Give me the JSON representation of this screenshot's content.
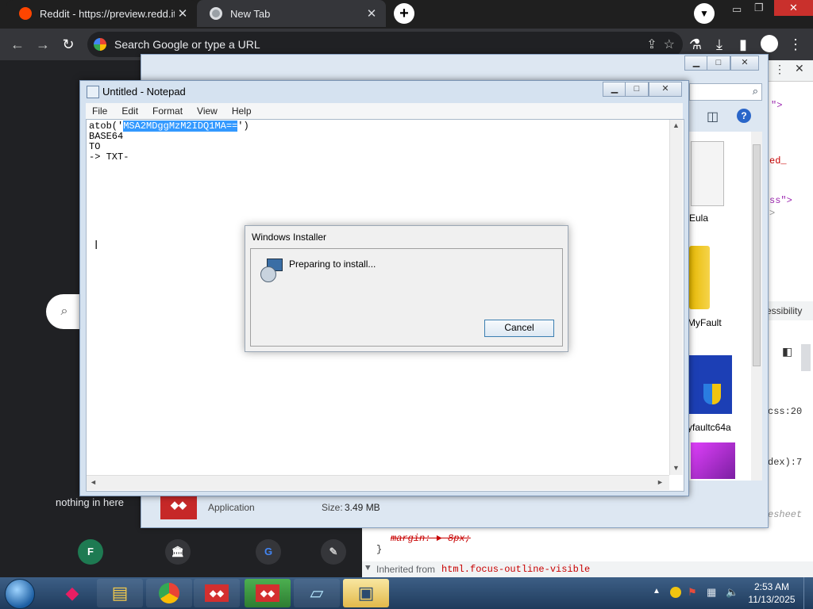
{
  "browser": {
    "tabs": [
      {
        "title": "Reddit - https://preview.redd.it/",
        "active": false
      },
      {
        "title": "New Tab",
        "active": true
      }
    ],
    "omnibox_placeholder": "Search Google or type a URL"
  },
  "ntp": {
    "shortcut_label": "nothing in here",
    "shortcut_letter": "F"
  },
  "devtools": {
    "snippets": [
      "\">",
      "ed_",
      "ss\">",
      ">",
      "essibility",
      "css:20",
      "dex):7",
      "esheet"
    ],
    "style_lines": [
      "margin: ► 8px;",
      "}"
    ],
    "inherited_label": "Inherited from",
    "inherited_selector": "html.focus-outline-visible"
  },
  "explorer": {
    "files": [
      {
        "name": "Eula"
      },
      {
        "name": "MyFault"
      },
      {
        "name": "yfaultc64a"
      }
    ],
    "details": {
      "type": "Application",
      "size_label": "Size:",
      "size_value": "3.49 MB"
    }
  },
  "notepad": {
    "title": "Untitled - Notepad",
    "menu": [
      "File",
      "Edit",
      "Format",
      "View",
      "Help"
    ],
    "lines": {
      "line1_prefix": "atob('",
      "line1_selected": "MSA2MDggMzM2IDQ1MA==",
      "line1_suffix": "')",
      "line2": "BASE64",
      "line3": "TO",
      "line4": "-> TXT-"
    }
  },
  "installer": {
    "title": "Windows Installer",
    "message": "Preparing to install...",
    "cancel_label": "Cancel"
  },
  "taskbar": {
    "time": "2:53 AM",
    "date": "11/13/2025"
  }
}
